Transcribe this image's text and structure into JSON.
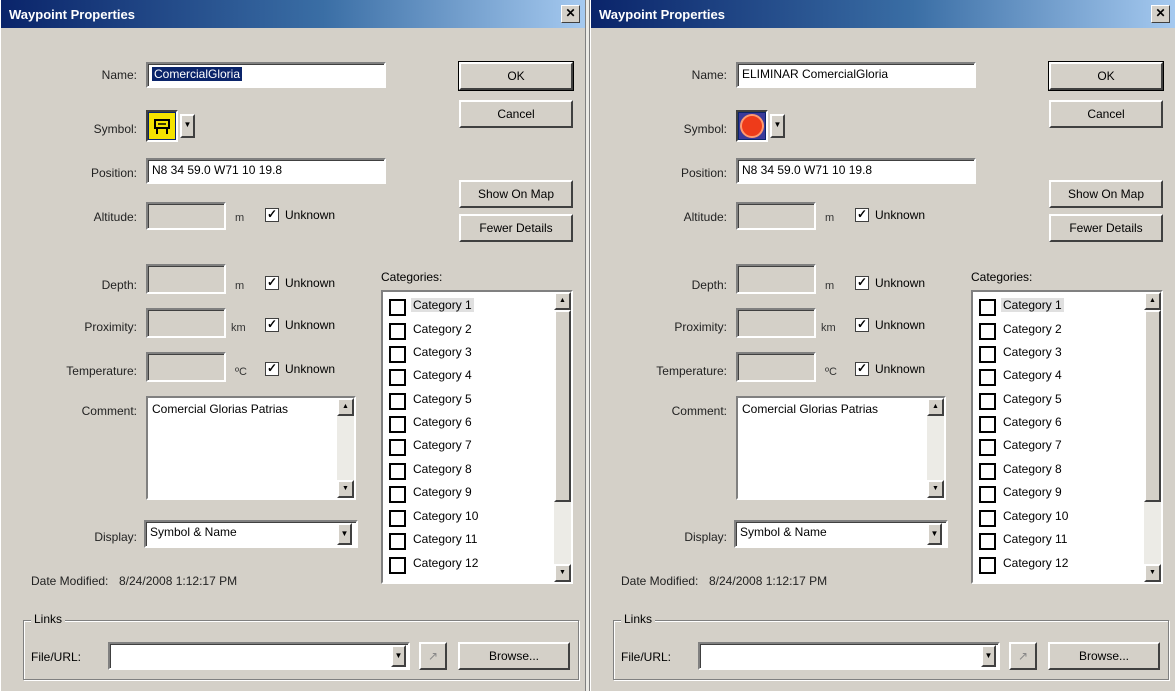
{
  "dialogs": [
    {
      "title": "Waypoint Properties",
      "close_glyph": "✕",
      "labels": {
        "name": "Name:",
        "symbol": "Symbol:",
        "position": "Position:",
        "altitude": "Altitude:",
        "depth": "Depth:",
        "proximity": "Proximity:",
        "temperature": "Temperature:",
        "comment": "Comment:",
        "display": "Display:",
        "date_modified": "Date Modified:",
        "categories": "Categories:",
        "links": "Links",
        "file_url": "File/URL:"
      },
      "name_value": "ComercialGloria",
      "name_selected": true,
      "symbol_icon": "building-sign-icon",
      "position_value": "N8 34 59.0 W71 10 19.8",
      "units": {
        "altitude": "m",
        "depth": "m",
        "proximity": "km",
        "temperature": "ºC"
      },
      "unknown_label": "Unknown",
      "unknown_checked": true,
      "comment_value": "Comercial Glorias Patrias",
      "display_value": "Symbol & Name",
      "date_modified_value": "8/24/2008 1:12:17 PM",
      "buttons": {
        "ok": "OK",
        "cancel": "Cancel",
        "show_on_map": "Show On Map",
        "fewer_details": "Fewer Details",
        "browse": "Browse..."
      },
      "categories": [
        "Category 1",
        "Category 2",
        "Category 3",
        "Category 4",
        "Category 5",
        "Category 6",
        "Category 7",
        "Category 8",
        "Category 9",
        "Category 10",
        "Category 11",
        "Category 12"
      ],
      "file_url_value": ""
    },
    {
      "title": "Waypoint Properties",
      "close_glyph": "✕",
      "labels": {
        "name": "Name:",
        "symbol": "Symbol:",
        "position": "Position:",
        "altitude": "Altitude:",
        "depth": "Depth:",
        "proximity": "Proximity:",
        "temperature": "Temperature:",
        "comment": "Comment:",
        "display": "Display:",
        "date_modified": "Date Modified:",
        "categories": "Categories:",
        "links": "Links",
        "file_url": "File/URL:"
      },
      "name_value": "ELIMINAR ComercialGloria",
      "name_selected": false,
      "symbol_icon": "red-circle-icon",
      "position_value": "N8 34 59.0 W71 10 19.8",
      "units": {
        "altitude": "m",
        "depth": "m",
        "proximity": "km",
        "temperature": "ºC"
      },
      "unknown_label": "Unknown",
      "unknown_checked": true,
      "comment_value": "Comercial Glorias Patrias",
      "display_value": "Symbol & Name",
      "date_modified_value": "8/24/2008 1:12:17 PM",
      "buttons": {
        "ok": "OK",
        "cancel": "Cancel",
        "show_on_map": "Show On Map",
        "fewer_details": "Fewer Details",
        "browse": "Browse..."
      },
      "categories": [
        "Category 1",
        "Category 2",
        "Category 3",
        "Category 4",
        "Category 5",
        "Category 6",
        "Category 7",
        "Category 8",
        "Category 9",
        "Category 10",
        "Category 11",
        "Category 12"
      ],
      "file_url_value": ""
    }
  ]
}
